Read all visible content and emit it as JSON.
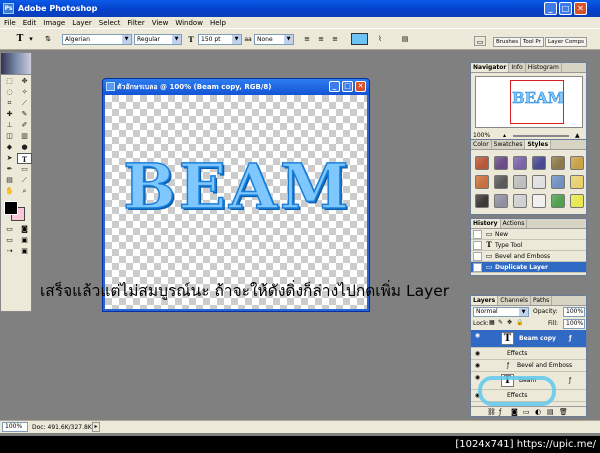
{
  "app": {
    "title": "Adobe Photoshop"
  },
  "menu": [
    "File",
    "Edit",
    "Image",
    "Layer",
    "Select",
    "Filter",
    "View",
    "Window",
    "Help"
  ],
  "options": {
    "tool_glyph": "T",
    "font_family": "Algerian",
    "font_style": "Regular",
    "font_size": "150 pt",
    "aa_label": "aa",
    "anti_alias": "None",
    "tabs": [
      "Brushes",
      "Tool Pr",
      "Layer Comps"
    ]
  },
  "document": {
    "title": "ตัวอักษรเบลอ @ 100% (Beam copy, RGB/8)",
    "text": "BEAM"
  },
  "navigator": {
    "tabs": [
      "Navigator",
      "Info",
      "Histogram"
    ],
    "zoom": "100%",
    "preview_text": "BEAM"
  },
  "styles": {
    "tabs": [
      "Color",
      "Swatches",
      "Styles"
    ],
    "colors": [
      "#b6583a",
      "#6b4c86",
      "#7a63a8",
      "#4a4a90",
      "#8c7a4a",
      "#c8a04a",
      "#c87040",
      "#5a5a5a",
      "#bdbdbd",
      "#e0e0e0",
      "#7090c0",
      "#e8d070",
      "#3a3a3a",
      "#9090a0",
      "#d0d0d0",
      "#f0f0f0",
      "#50a050",
      "#e8e850"
    ]
  },
  "history": {
    "tabs": [
      "History",
      "Actions"
    ],
    "items": [
      {
        "label": "New",
        "icon": "▭"
      },
      {
        "label": "Type Tool",
        "icon": "T"
      },
      {
        "label": "Bevel and Emboss",
        "icon": "▭"
      },
      {
        "label": "Duplicate Layer",
        "icon": "▭"
      }
    ]
  },
  "layers": {
    "tabs": [
      "Layers",
      "Channels",
      "Paths"
    ],
    "blend_mode": "Normal",
    "opacity_label": "Opacity:",
    "opacity": "100%",
    "lock_label": "Lock:",
    "fill_label": "Fill:",
    "fill": "100%",
    "rows": [
      {
        "label": "Beam copy",
        "kind": "layer",
        "active": true
      },
      {
        "label": "Effects",
        "kind": "effects",
        "active": true
      },
      {
        "label": "Bevel and Emboss",
        "kind": "effect",
        "active": true
      },
      {
        "label": "Beam",
        "kind": "layer",
        "active": false
      },
      {
        "label": "Effects",
        "kind": "effects",
        "active": false
      }
    ]
  },
  "status": {
    "zoom": "100%",
    "doc": "Doc: 491.6K/327.8K"
  },
  "overlay_text": "เสร็จแล้วแต่ไม่สมบูรณ์นะ ถ้าจะให้ดังดิ่งก็ล่างไปกดเพิ่ม Layer",
  "credit": "[1024x741] https://upic.me/"
}
